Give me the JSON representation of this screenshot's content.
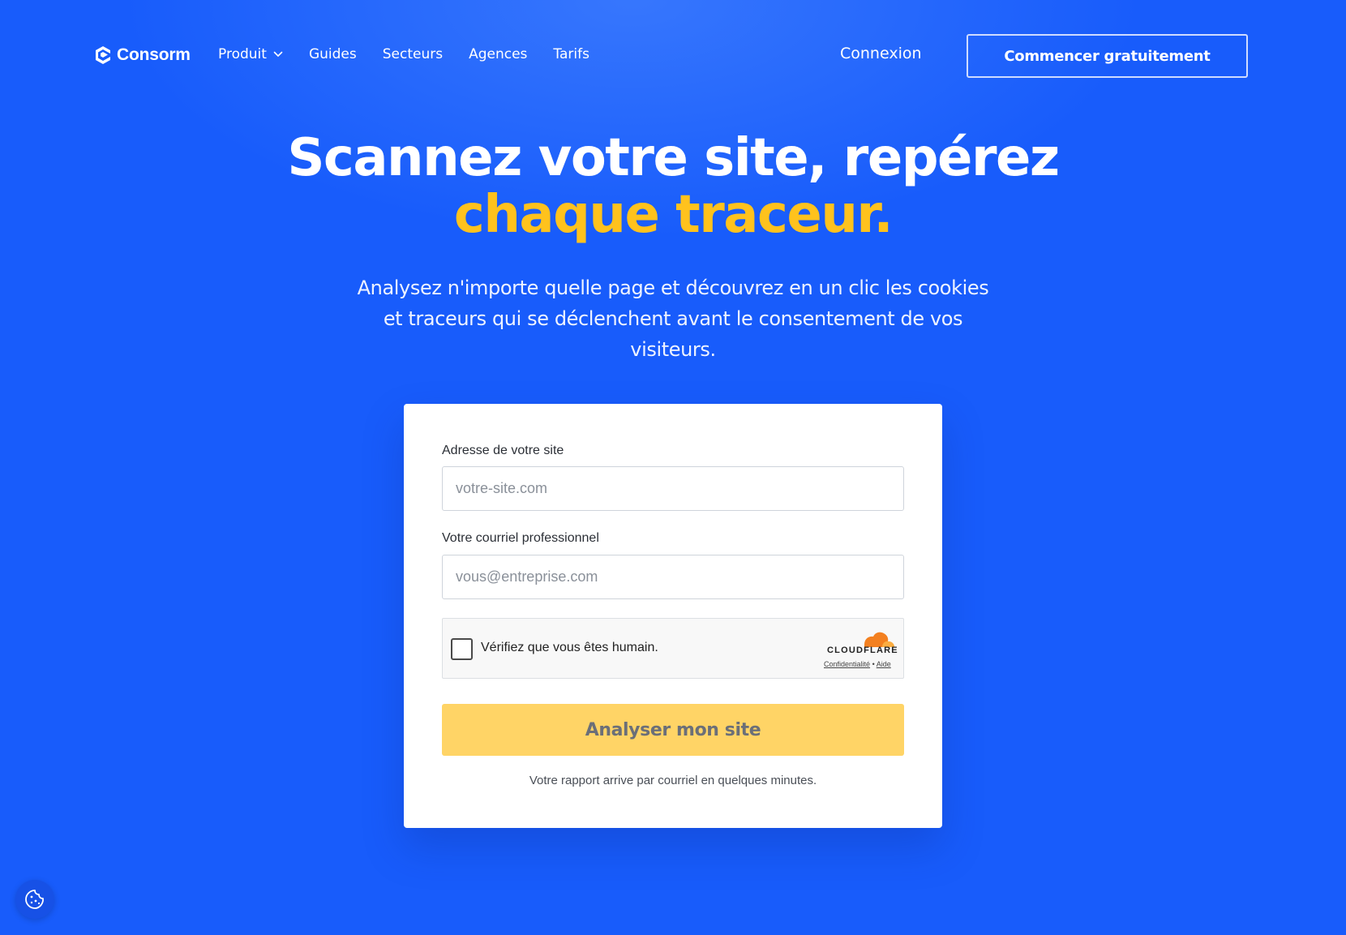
{
  "brand": {
    "name": "Consorm",
    "logo_icon": "consorm-logo-icon"
  },
  "nav": {
    "items": [
      {
        "label": "Produit",
        "has_dropdown": true,
        "icon": "chevron-down-icon"
      },
      {
        "label": "Guides"
      },
      {
        "label": "Secteurs"
      },
      {
        "label": "Agences"
      },
      {
        "label": "Tarifs"
      }
    ],
    "login_label": "Connexion",
    "cta_label": "Commencer gratuitement"
  },
  "hero": {
    "title_line1": "Scannez votre site, repérez",
    "title_line2": "chaque traceur.",
    "subtitle": "Analysez n'importe quelle page et découvrez en un clic les cookies et traceurs qui se déclenchent avant le consentement de vos visiteurs."
  },
  "form": {
    "site_label": "Adresse de votre site",
    "site_placeholder": "votre-site.com",
    "site_value": "",
    "email_label": "Votre courriel professionnel",
    "email_placeholder": "vous@entreprise.com",
    "email_value": "",
    "captcha": {
      "checked": false,
      "text": "Vérifiez que vous êtes humain.",
      "provider": "CLOUDFLARE",
      "privacy_link": "Confidentialité",
      "separator": "•",
      "help_link": "Aide"
    },
    "submit_label": "Analyser mon site",
    "note": "Votre rapport arrive par courriel en quelques minutes."
  },
  "cookie_widget": {
    "icon": "cookie-icon"
  },
  "colors": {
    "background": "#185cfb",
    "accent": "#ffc21d",
    "button": "#ffd466",
    "cloudflare_orange": "#f38020"
  }
}
